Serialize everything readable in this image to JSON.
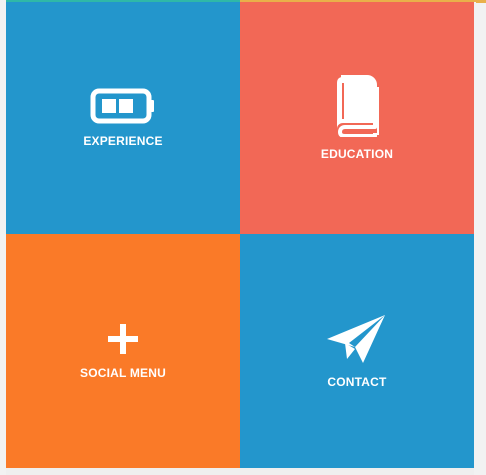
{
  "tiles": [
    {
      "label": "EXPERIENCE",
      "icon": "battery-icon",
      "color": "#2396cc"
    },
    {
      "label": "EDUCATION",
      "icon": "book-icon",
      "color": "#f26856"
    },
    {
      "label": "SOCIAL MENU",
      "icon": "plus-icon",
      "color": "#fa7a28"
    },
    {
      "label": "CONTACT",
      "icon": "paper-plane-icon",
      "color": "#2396cc"
    }
  ]
}
